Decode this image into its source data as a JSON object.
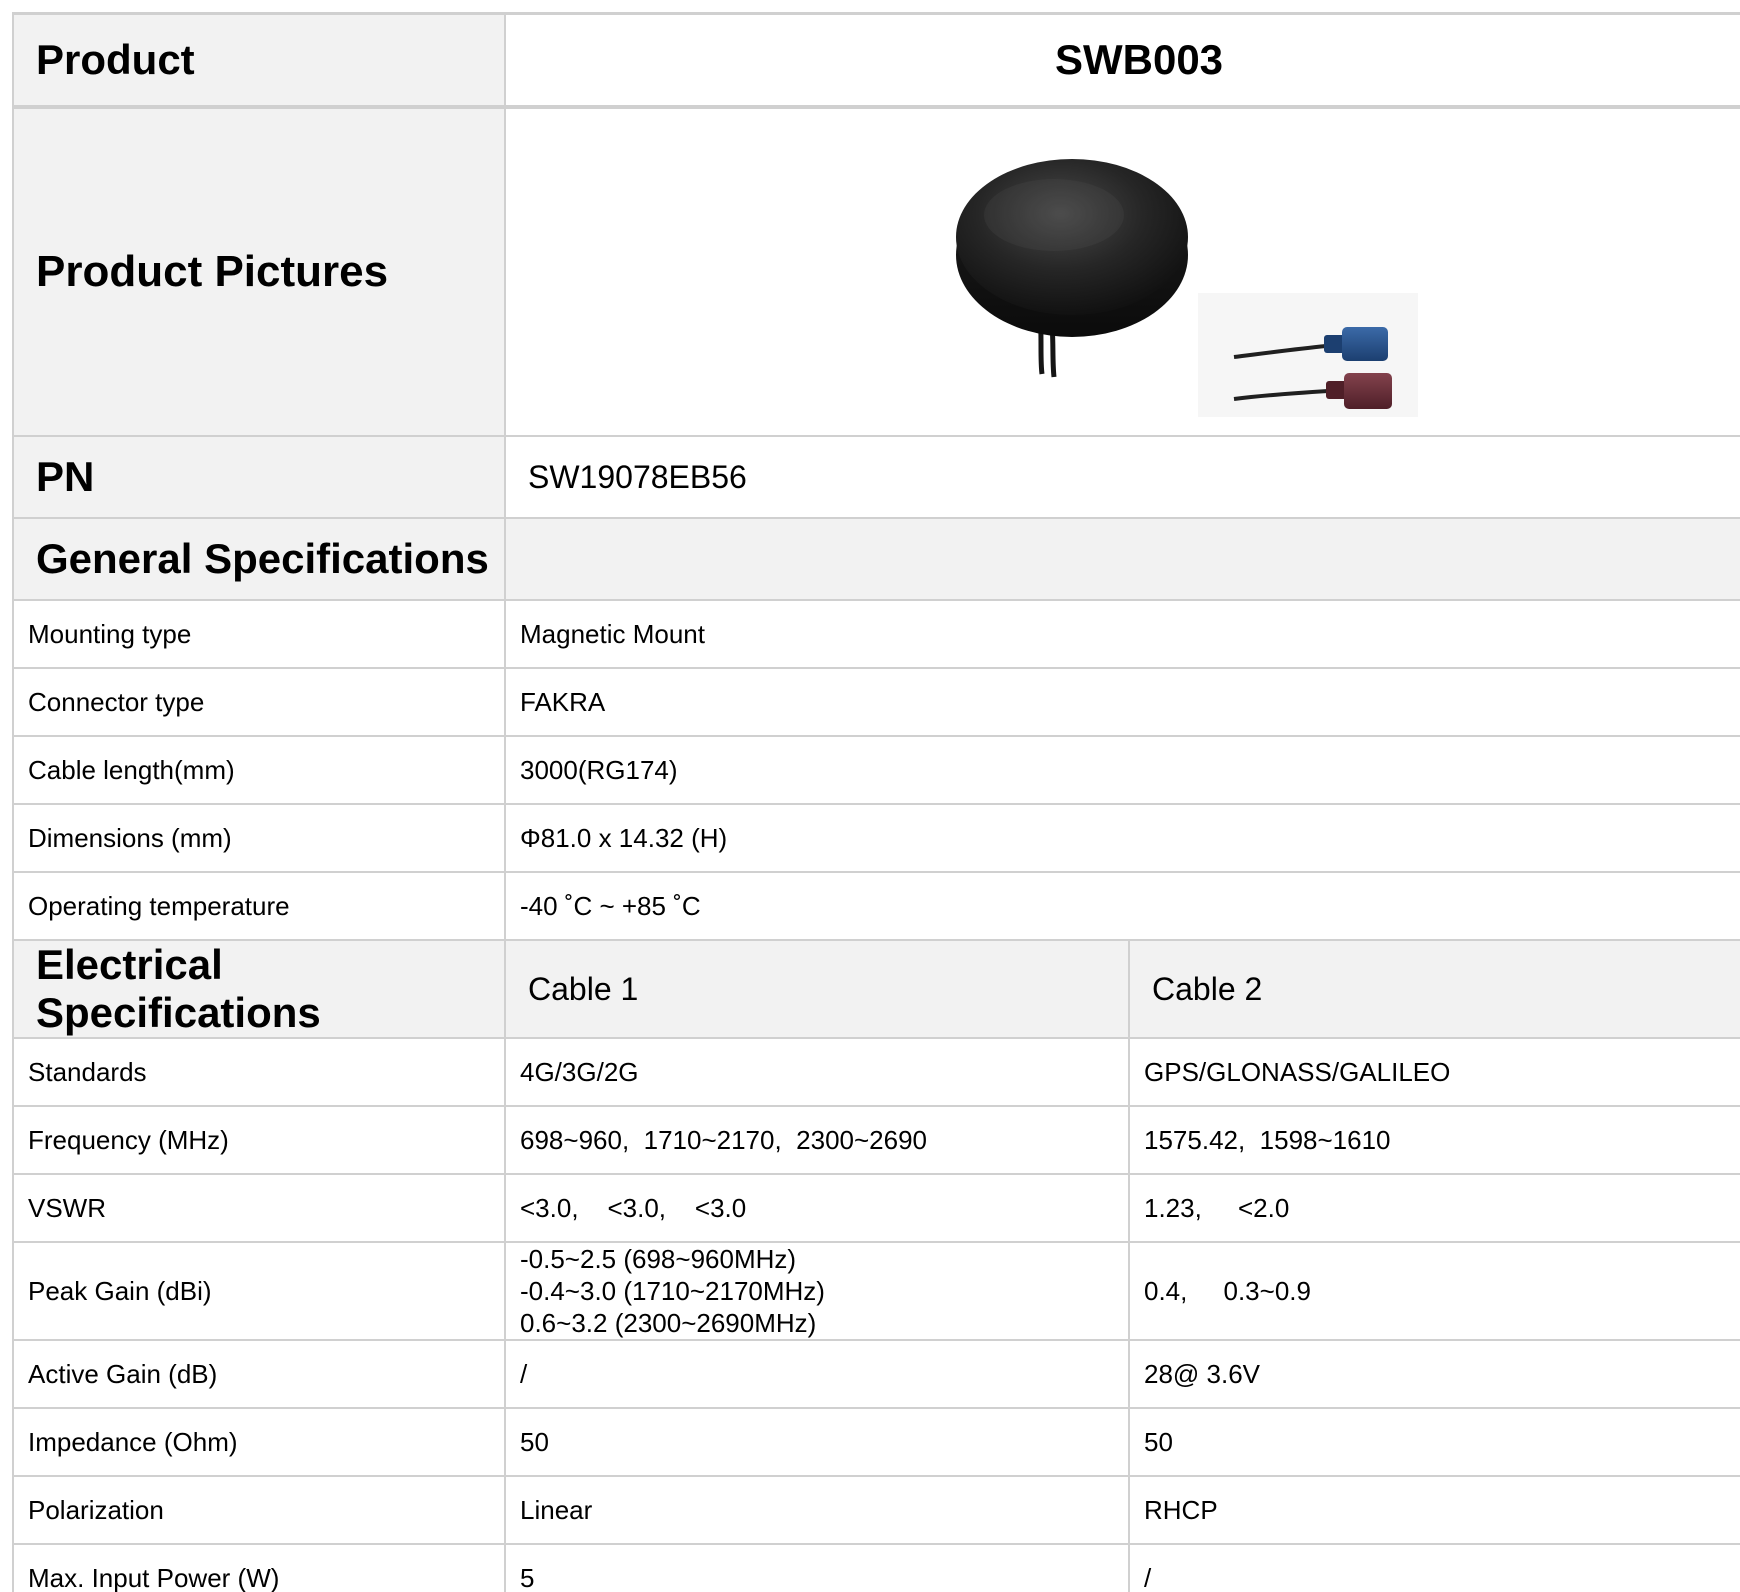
{
  "header": {
    "label": "Product",
    "value": "SWB003"
  },
  "pictures": {
    "label": "Product Pictures",
    "image": "antenna-puck-with-fakra-connectors"
  },
  "pn": {
    "label": "PN",
    "value": "SW19078EB56"
  },
  "general": {
    "heading": "General Specifications",
    "rows": [
      {
        "label": "Mounting type",
        "value": "Magnetic Mount"
      },
      {
        "label": "Connector type",
        "value": "FAKRA"
      },
      {
        "label": "Cable length(mm)",
        "value": "3000(RG174)"
      },
      {
        "label": "Dimensions (mm)",
        "value": "Φ81.0 x 14.32 (H)"
      },
      {
        "label": "Operating temperature",
        "value": "-40 ˚C ~ +85 ˚C"
      }
    ]
  },
  "electrical": {
    "heading": "Electrical Specifications",
    "cable1": "Cable 1",
    "cable2": "Cable 2",
    "rows": [
      {
        "label": "Standards",
        "c1": "4G/3G/2G",
        "c2": "GPS/GLONASS/GALILEO"
      },
      {
        "label": "Frequency (MHz)",
        "c1": "698~960,  1710~2170,  2300~2690",
        "c2": "1575.42,  1598~1610"
      },
      {
        "label": "VSWR",
        "c1": "<3.0,    <3.0,    <3.0",
        "c2": "1.23,     <2.0"
      },
      {
        "label": "Peak Gain (dBi)",
        "c1_lines": [
          "-0.5~2.5 (698~960MHz)",
          "-0.4~3.0 (1710~2170MHz)",
          "0.6~3.2 (2300~2690MHz)"
        ],
        "c2": "0.4,     0.3~0.9"
      },
      {
        "label": "Active Gain (dB)",
        "c1": "/",
        "c2": "28@ 3.6V"
      },
      {
        "label": "Impedance (Ohm)",
        "c1": "50",
        "c2": "50"
      },
      {
        "label": "Polarization",
        "c1": "Linear",
        "c2": "RHCP"
      },
      {
        "label": "Max. Input Power (W)",
        "c1": "5",
        "c2": "/"
      }
    ]
  },
  "colors": {
    "header_bg": "#f2f2f2",
    "border": "#d0d0d0",
    "connector_blue": "#24508a",
    "connector_bordeaux": "#6b2e38"
  }
}
